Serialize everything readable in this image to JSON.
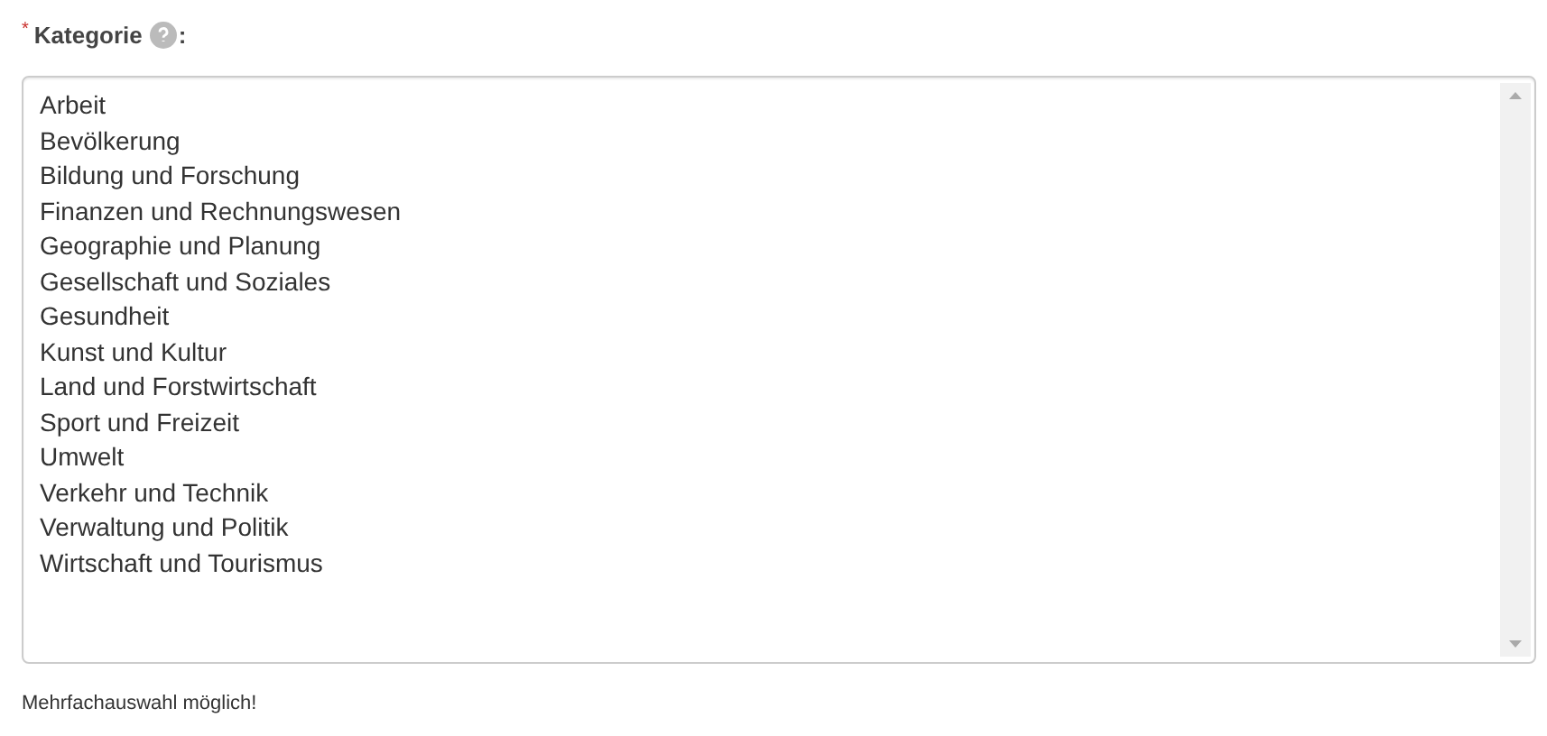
{
  "field": {
    "required_mark": "*",
    "label": "Kategorie",
    "label_suffix": ":",
    "options": [
      {
        "label": "Arbeit",
        "selected": false
      },
      {
        "label": "Bevölkerung",
        "selected": false
      },
      {
        "label": "Bildung und Forschung",
        "selected": false
      },
      {
        "label": "Finanzen und Rechnungswesen",
        "selected": false
      },
      {
        "label": "Geographie und Planung",
        "selected": false
      },
      {
        "label": "Gesellschaft und Soziales",
        "selected": false
      },
      {
        "label": "Gesundheit",
        "selected": false
      },
      {
        "label": "Kunst und Kultur",
        "selected": false
      },
      {
        "label": "Land und Forstwirtschaft",
        "selected": false
      },
      {
        "label": "Sport und Freizeit",
        "selected": false
      },
      {
        "label": "Umwelt",
        "selected": false
      },
      {
        "label": "Verkehr und Technik",
        "selected": false
      },
      {
        "label": "Verwaltung und Politik",
        "selected": false
      },
      {
        "label": "Wirtschaft und Tourismus",
        "selected": false
      }
    ],
    "hint": "Mehrfachauswahl möglich!"
  }
}
